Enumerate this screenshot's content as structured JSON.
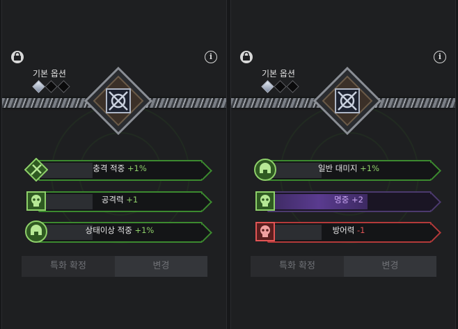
{
  "panels": [
    {
      "base_label": "기본 옵션",
      "gems": [
        true,
        false,
        false
      ],
      "options": [
        {
          "name": "충격 적중",
          "value": "+1%",
          "style": "green",
          "icon": "crossed-sword-icon",
          "fill": 0.32
        },
        {
          "name": "공격력",
          "value": "+1",
          "style": "green",
          "icon": "skull-icon",
          "fill": 0.32
        },
        {
          "name": "상태이상 적중",
          "value": "+1%",
          "style": "green",
          "icon": "helmet-icon",
          "fill": 0.32
        }
      ],
      "buttons": {
        "spec": "특화 확정",
        "change": "변경"
      }
    },
    {
      "base_label": "기본 옵션",
      "gems": [
        true,
        false,
        false
      ],
      "options": [
        {
          "name": "일반 대미지",
          "value": "+1%",
          "style": "green",
          "icon": "helmet-icon",
          "fill": 0.32
        },
        {
          "name": "명중",
          "value": "+2",
          "style": "purple",
          "icon": "skull-icon",
          "fill": 0.6
        },
        {
          "name": "방어력",
          "value": "-1",
          "style": "red",
          "icon": "skull-icon",
          "fill": 0.32
        }
      ],
      "buttons": {
        "spec": "특화 확정",
        "change": "변경"
      }
    }
  ],
  "colors": {
    "green": "#3c8a2f",
    "purple": "#5a3b8f",
    "red": "#b43a3a"
  }
}
